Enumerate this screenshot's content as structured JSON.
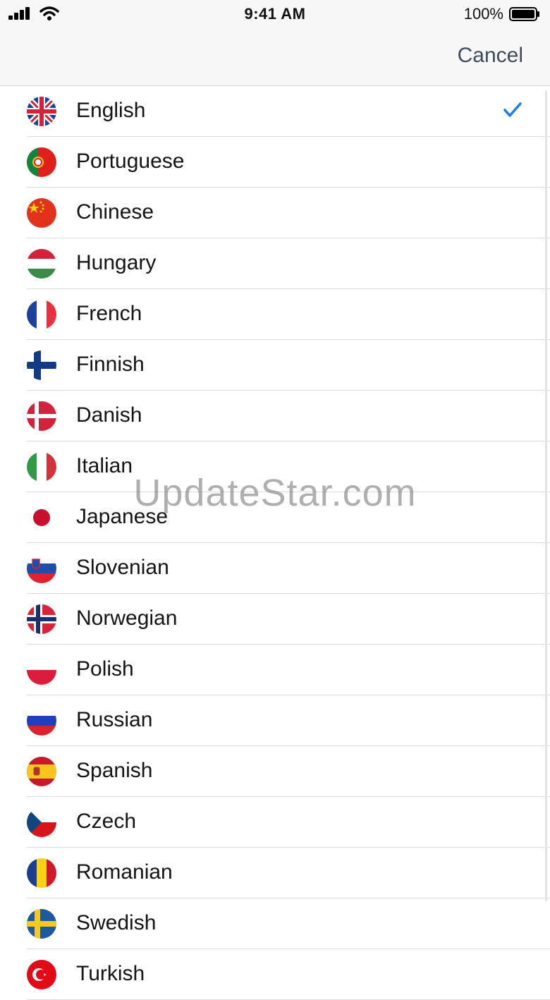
{
  "status_bar": {
    "time": "9:41 AM",
    "battery_percent": "100%",
    "signal_icon": "signal-bars-icon",
    "wifi_icon": "wifi-icon",
    "battery_icon": "battery-full-icon"
  },
  "nav": {
    "cancel_label": "Cancel"
  },
  "languages": [
    {
      "label": "English",
      "flag": "uk-flag-icon",
      "selected": true
    },
    {
      "label": "Portuguese",
      "flag": "portugal-flag-icon",
      "selected": false
    },
    {
      "label": "Chinese",
      "flag": "china-flag-icon",
      "selected": false
    },
    {
      "label": "Hungary",
      "flag": "hungary-flag-icon",
      "selected": false
    },
    {
      "label": "French",
      "flag": "france-flag-icon",
      "selected": false
    },
    {
      "label": "Finnish",
      "flag": "finland-flag-icon",
      "selected": false
    },
    {
      "label": "Danish",
      "flag": "denmark-flag-icon",
      "selected": false
    },
    {
      "label": "Italian",
      "flag": "italy-flag-icon",
      "selected": false
    },
    {
      "label": "Japanese",
      "flag": "japan-flag-icon",
      "selected": false
    },
    {
      "label": "Slovenian",
      "flag": "slovenia-flag-icon",
      "selected": false
    },
    {
      "label": "Norwegian",
      "flag": "norway-flag-icon",
      "selected": false
    },
    {
      "label": "Polish",
      "flag": "poland-flag-icon",
      "selected": false
    },
    {
      "label": "Russian",
      "flag": "russia-flag-icon",
      "selected": false
    },
    {
      "label": "Spanish",
      "flag": "spain-flag-icon",
      "selected": false
    },
    {
      "label": "Czech",
      "flag": "czech-flag-icon",
      "selected": false
    },
    {
      "label": "Romanian",
      "flag": "romania-flag-icon",
      "selected": false
    },
    {
      "label": "Swedish",
      "flag": "sweden-flag-icon",
      "selected": false
    },
    {
      "label": "Turkish",
      "flag": "turkey-flag-icon",
      "selected": false
    }
  ],
  "checkmark_icon": "checkmark-icon",
  "watermark": "UpdateStar.com",
  "colors": {
    "accent": "#1a7cf5",
    "cancel": "#3f4a5a"
  }
}
